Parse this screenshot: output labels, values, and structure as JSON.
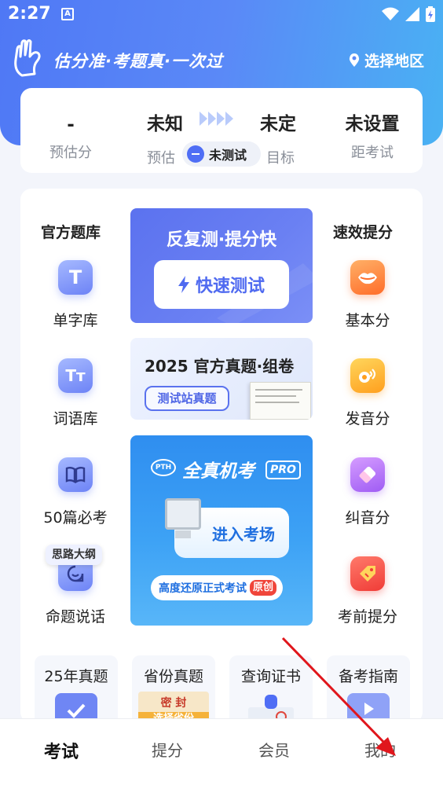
{
  "status": {
    "time": "2:27",
    "a_icon": "A"
  },
  "header": {
    "slogan": "估分准·考题真·一次过",
    "region": "选择地区"
  },
  "score": {
    "estimate_value": "-",
    "estimate_label": "预估分",
    "from_value": "未知",
    "from_label": "预估",
    "to_value": "未定",
    "to_label": "目标",
    "status_badge": "未测试",
    "exam_value": "未设置",
    "exam_label": "距考试"
  },
  "left_column": {
    "title": "官方题库",
    "items": [
      {
        "label": "单字库",
        "glyph": "T",
        "icon": "single-char-icon"
      },
      {
        "label": "词语库",
        "glyph": "TT",
        "icon": "words-icon"
      },
      {
        "label": "50篇必考",
        "glyph": "📖",
        "icon": "book-icon"
      },
      {
        "label": "命题说话",
        "glyph": "",
        "icon": "speech-icon",
        "badge": "思路大纲"
      }
    ]
  },
  "right_column": {
    "title": "速效提分",
    "items": [
      {
        "label": "基本分",
        "icon": "mouth-icon"
      },
      {
        "label": "发音分",
        "icon": "pronunciation-icon"
      },
      {
        "label": "纠音分",
        "icon": "eraser-icon"
      },
      {
        "label": "考前提分",
        "icon": "tag-icon"
      }
    ]
  },
  "panels": {
    "quick": {
      "title": "反复测·提分快",
      "button": "快速测试"
    },
    "papers": {
      "title": "2025 官方真题·组卷",
      "button": "测试站真题"
    },
    "exam": {
      "logo": "PTH",
      "title": "全真机考",
      "pro": "PRO",
      "button": "进入考场",
      "note": "高度还原正式考试",
      "note_badge": "原创"
    }
  },
  "bottom_cards": [
    {
      "label": "25年真题"
    },
    {
      "label": "省份真题",
      "stamp": "密 封",
      "strip": "选择省份"
    },
    {
      "label": "查询证书"
    },
    {
      "label": "备考指南"
    }
  ],
  "tabs": [
    {
      "label": "考试"
    },
    {
      "label": "提分"
    },
    {
      "label": "会员"
    },
    {
      "label": "我的"
    }
  ],
  "colors": {
    "primary": "#4f6ef5",
    "header_gradient_end": "#49b2f3",
    "annotation_arrow": "#e0161c"
  }
}
